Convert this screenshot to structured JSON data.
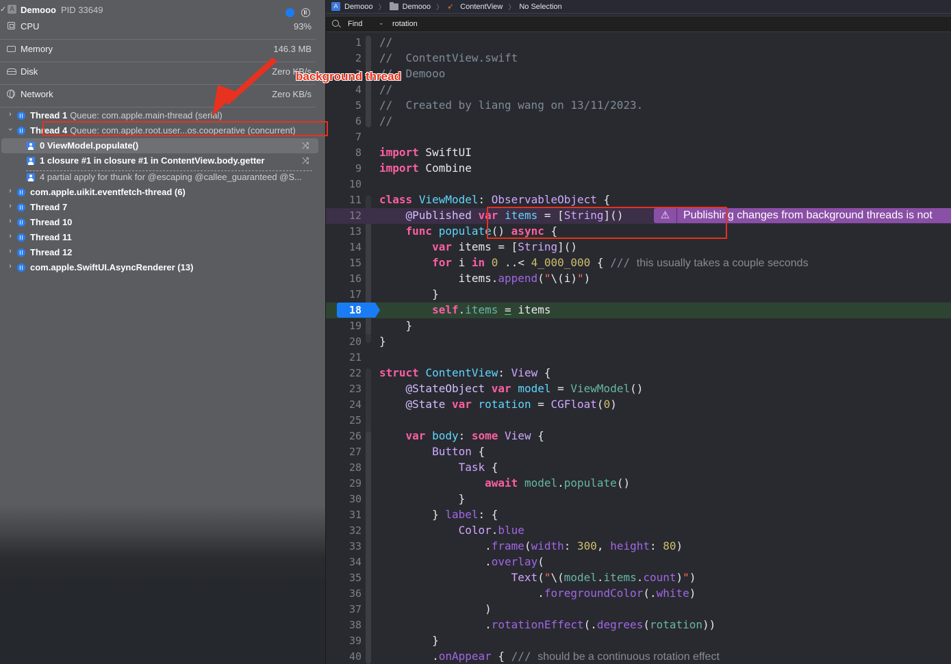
{
  "process": {
    "name": "Demooo",
    "pid": "PID 33649",
    "gauges": [
      {
        "label": "CPU",
        "value": "93%",
        "icon": "cpu-icon"
      },
      {
        "label": "Memory",
        "value": "146.3 MB",
        "icon": "memory-icon"
      },
      {
        "label": "Disk",
        "value": "Zero KB/s",
        "icon": "disk-icon"
      },
      {
        "label": "Network",
        "value": "Zero KB/s",
        "icon": "network-icon"
      }
    ]
  },
  "threads": [
    {
      "name": "Thread 1",
      "queue": "Queue: com.apple.main-thread (serial)",
      "expanded": false
    },
    {
      "name": "Thread 4",
      "queue": "Queue: com.apple.root.user...os.cooperative (concurrent)",
      "expanded": true,
      "frames": [
        {
          "label": "0 ViewModel.populate()",
          "selected": true
        },
        {
          "label": "1 closure #1 in closure #1 in ContentView.body.getter",
          "selected": false
        },
        {
          "label": "4 partial apply for thunk for @escaping @callee_guaranteed @S...",
          "selected": false
        }
      ]
    },
    {
      "name": "com.apple.uikit.eventfetch-thread (6)",
      "queue": ""
    },
    {
      "name": "Thread 7",
      "queue": ""
    },
    {
      "name": "Thread 10",
      "queue": ""
    },
    {
      "name": "Thread 11",
      "queue": ""
    },
    {
      "name": "Thread 12",
      "queue": ""
    },
    {
      "name": "com.apple.SwiftUI.AsyncRenderer (13)",
      "queue": ""
    }
  ],
  "breadcrumb": [
    "Demooo",
    "Demooo",
    "ContentView",
    "No Selection"
  ],
  "find": {
    "mode": "Find",
    "query": "rotation"
  },
  "editor": {
    "current_line": 18,
    "warning_line": 12,
    "warning_text": "Publishing changes from background threads is not",
    "lines": [
      "1",
      "2",
      "3",
      "4",
      "5",
      "6",
      "7",
      "8",
      "9",
      "10",
      "11",
      "12",
      "13",
      "14",
      "15",
      "16",
      "17",
      "18",
      "19",
      "20",
      "21",
      "22",
      "23",
      "24",
      "25",
      "26",
      "27",
      "28",
      "29",
      "30",
      "31",
      "32",
      "33",
      "34",
      "35",
      "36",
      "37",
      "38",
      "39",
      "40"
    ],
    "code": {
      "l2": "ContentView.swift",
      "l3": "Demooo",
      "l5": "Created by liang wang on 13/11/2023.",
      "l15_comment": "this usually takes a couple seconds",
      "l40_comment": "should be a continuous rotation effect"
    }
  },
  "annotation": {
    "label": "background thread",
    "color": "#e6321f"
  }
}
